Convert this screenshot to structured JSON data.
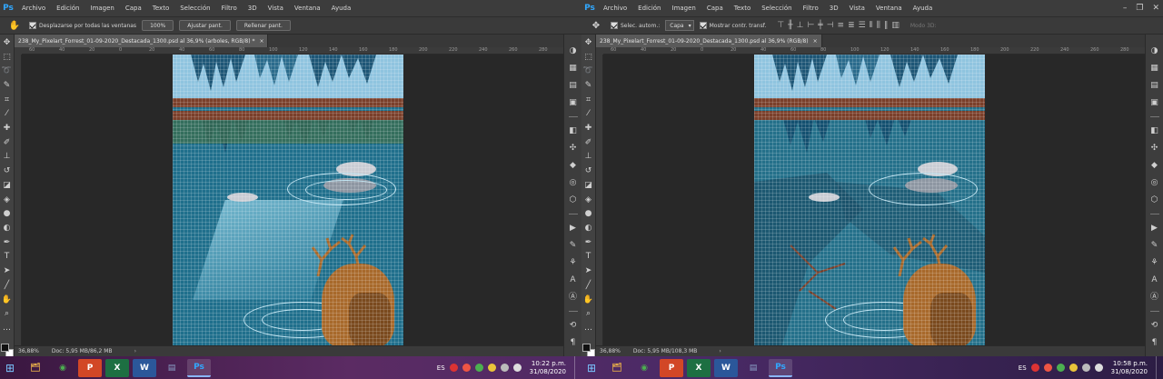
{
  "menu": [
    "Archivo",
    "Edición",
    "Imagen",
    "Capa",
    "Texto",
    "Selección",
    "Filtro",
    "3D",
    "Vista",
    "Ventana",
    "Ayuda"
  ],
  "app_logo": "Ps",
  "left": {
    "options": {
      "checkbox_label": "Desplazarse por todas las ventanas",
      "zoom_value": "100%",
      "fit_button": "Ajustar pant.",
      "fill_button": "Rellenar pant."
    },
    "tab_title": "238_My_Pixelart_Forrest_01-09-2020_Destacada_1300.psd al 36,9% (arboles, RGB/8) *",
    "zoom": "36,88%",
    "doc_size": "Doc: 5,95 MB/86,2 MB"
  },
  "right": {
    "options": {
      "auto_select_label": "Selec. autom.:",
      "auto_select_value": "Capa",
      "transform_label": "Mostrar contr. transf.",
      "mode_3d": "Modo 3D:"
    },
    "tab_title": "238_My_Pixelart_Forrest_01-09-2020_Destacada_1300.psd al 36,9% (RGB/8)",
    "zoom": "36,88%",
    "doc_size": "Doc: 5,95 MB/108,3 MB"
  },
  "ruler_ticks": [
    "60",
    "40",
    "20",
    "0",
    "20",
    "40",
    "60",
    "80",
    "100",
    "120",
    "140",
    "160",
    "180",
    "200",
    "220",
    "240",
    "260",
    "280"
  ],
  "taskbar": {
    "language": "ES",
    "left_clock": {
      "time": "10:22 p.m.",
      "date": "31/08/2020"
    },
    "right_clock": {
      "time": "10:58 p.m.",
      "date": "31/08/2020"
    },
    "apps": [
      {
        "name": "explorer",
        "glyph": "🗂",
        "color": "#e0a84a"
      },
      {
        "name": "chrome",
        "glyph": "◉",
        "color": "#4caf50"
      },
      {
        "name": "powerpoint",
        "glyph": "P",
        "color": "#d24726"
      },
      {
        "name": "excel",
        "glyph": "X",
        "color": "#1d6f42"
      },
      {
        "name": "word",
        "glyph": "W",
        "color": "#2b579a"
      },
      {
        "name": "notes",
        "glyph": "▤",
        "color": "#8aa2c8"
      },
      {
        "name": "photoshop",
        "glyph": "Ps",
        "color": "#0c2a4a"
      }
    ]
  },
  "colors": {
    "ps_accent": "#31a8ff",
    "water": "#1f6f8c",
    "sky": "#8fc4df",
    "deer": "#a8692b"
  }
}
